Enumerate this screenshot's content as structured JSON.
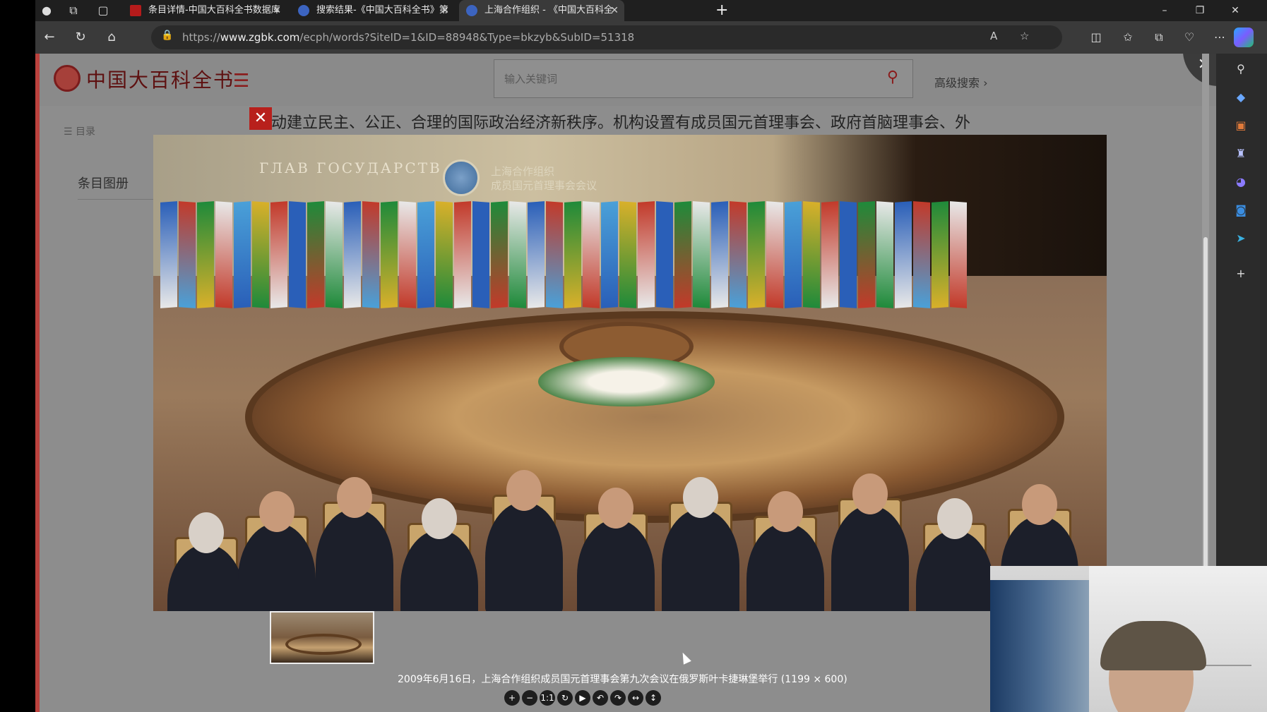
{
  "browser": {
    "tabs": [
      {
        "label": "条目详情-中国大百科全书数据库",
        "active": false
      },
      {
        "label": "搜索结果-《中国大百科全书》第",
        "active": false
      },
      {
        "label": "上海合作组织 - 《中国大百科全",
        "active": true
      }
    ],
    "new_tab": "+",
    "url_prefix": "https://",
    "url_domain": "www.zgbk.com",
    "url_path": "/ecph/words?SiteID=1&ID=88948&Type=bkzyb&SubID=51318",
    "read_aloud": "A",
    "window_controls": {
      "minimize": "–",
      "maximize": "❐",
      "close": "✕"
    }
  },
  "site": {
    "logo_text": "中国大百科全书",
    "menu_icon": "☰",
    "search_placeholder": "输入关键词",
    "search_icon": "⚲",
    "advanced_search": "高级搜索 ›",
    "close_icon": "✕"
  },
  "sidebar": {
    "toc_label": "☰  目录",
    "active_item": "条目图册"
  },
  "article": {
    "visible_line": "动建立民主、公正、合理的国际政治经济新秩序。机构设置有成员国元首理事会、政府首脑理事会、外"
  },
  "lightbox": {
    "close": "✕",
    "banner_text": "ГЛАВ ГОСУДАРСТВ",
    "banner_cn": "上海合作组织\n成员国元首理事会会议",
    "caption": "2009年6月16日，上海合作组织成员国元首理事会第九次会议在俄罗斯叶卡捷琳堡举行 (1199 × 600)",
    "toolbar": [
      {
        "name": "zoom-in-button",
        "glyph": "+"
      },
      {
        "name": "zoom-out-button",
        "glyph": "−"
      },
      {
        "name": "actual-size-button",
        "glyph": "1:1"
      },
      {
        "name": "reset-button",
        "glyph": "↻"
      },
      {
        "name": "play-button",
        "glyph": "▶"
      },
      {
        "name": "rotate-left-button",
        "glyph": "↶"
      },
      {
        "name": "rotate-right-button",
        "glyph": "↷"
      },
      {
        "name": "flip-horizontal-button",
        "glyph": "↔"
      },
      {
        "name": "flip-vertical-button",
        "glyph": "↕"
      }
    ]
  },
  "colors": {
    "brand_red": "#b8201c",
    "overlay_gray": "#8d8d8d",
    "browser_dark": "#202124"
  }
}
